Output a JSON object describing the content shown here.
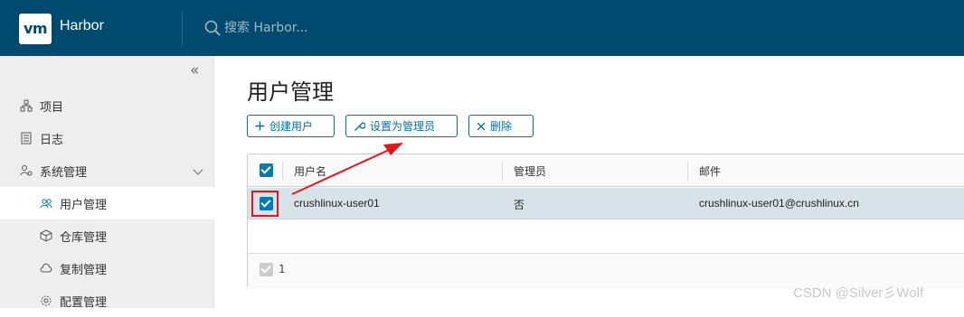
{
  "header": {
    "logo_text": "vm",
    "app_name": "Harbor",
    "search_placeholder": "搜索 Harbor..."
  },
  "sidebar": {
    "collapse_glyph": "«",
    "items": [
      {
        "label": "项目",
        "icon": "projects-icon"
      },
      {
        "label": "日志",
        "icon": "logs-icon"
      },
      {
        "label": "系统管理",
        "icon": "admin-users-icon",
        "expanded": true
      },
      {
        "label": "用户管理",
        "icon": "users-icon",
        "active": true
      },
      {
        "label": "仓库管理",
        "icon": "box-icon"
      },
      {
        "label": "复制管理",
        "icon": "cloud-icon"
      },
      {
        "label": "配置管理",
        "icon": "gear-icon"
      }
    ]
  },
  "main": {
    "title": "用户管理",
    "buttons": {
      "create": "创建用户",
      "set_admin": "设置为管理员",
      "delete": "删除"
    },
    "table": {
      "columns": [
        "用户名",
        "管理员",
        "邮件"
      ],
      "rows": [
        {
          "username": "crushlinux-user01",
          "admin": "否",
          "email": "crushlinux-user01@crushlinux.cn",
          "selected": true
        }
      ],
      "selected_count": "1"
    }
  },
  "colors": {
    "header_bg": "#004a70",
    "accent": "#0072a3",
    "annotation": "#e4161c"
  },
  "watermark": "CSDN @Silver彡Wolf"
}
